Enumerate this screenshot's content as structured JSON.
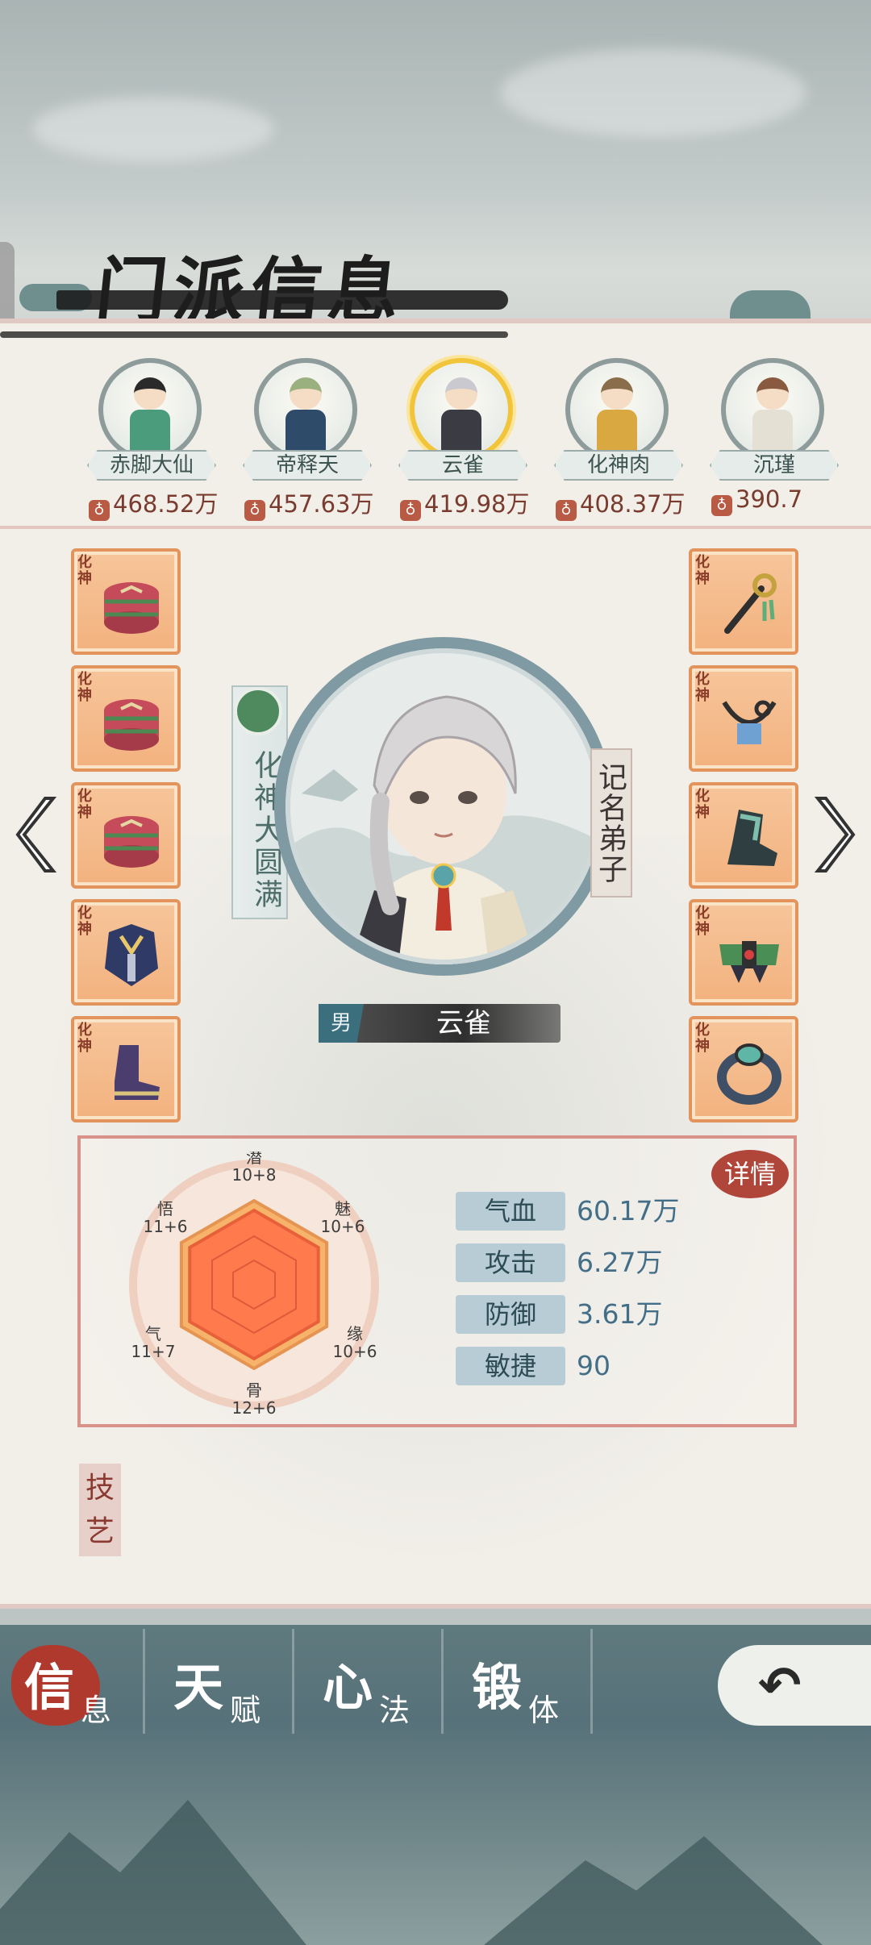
{
  "header": {
    "title": "门派信息"
  },
  "roster": [
    {
      "name": "赤脚大仙",
      "power": "468.52万",
      "hair": "#2a2a2a",
      "cloth": "#4a9c7d",
      "selected": false
    },
    {
      "name": "帝释天",
      "power": "457.63万",
      "hair": "#9bb07f",
      "cloth": "#2f4b6a",
      "selected": false
    },
    {
      "name": "云雀",
      "power": "419.98万",
      "hair": "#c9c9cf",
      "cloth": "#3b3b44",
      "selected": true
    },
    {
      "name": "化神肉",
      "power": "408.37万",
      "hair": "#8a6d4a",
      "cloth": "#d9a840",
      "selected": false
    },
    {
      "name": "沉瑾",
      "power": "390.7",
      "hair": "#8a5a40",
      "cloth": "#e4e0d4",
      "selected": false
    }
  ],
  "equipment": {
    "tag": "化神",
    "left": [
      "drum-icon",
      "drum-icon",
      "drum-icon",
      "armor-icon",
      "boot-icon"
    ],
    "right": [
      "staff-icon",
      "necklace-icon",
      "boot-jade-icon",
      "belt-icon",
      "ring-icon"
    ]
  },
  "character": {
    "realm": "化神大圆满",
    "rank": "记名弟子",
    "gender": "男",
    "name": "云雀"
  },
  "radar": {
    "axes": [
      {
        "key": "潜",
        "value": "10+8"
      },
      {
        "key": "魅",
        "value": "10+6"
      },
      {
        "key": "缘",
        "value": "10+6"
      },
      {
        "key": "骨",
        "value": "12+6"
      },
      {
        "key": "气",
        "value": "11+7"
      },
      {
        "key": "悟",
        "value": "11+6"
      }
    ]
  },
  "stats": [
    {
      "label": "气血",
      "value": "60.17万"
    },
    {
      "label": "攻击",
      "value": "6.27万"
    },
    {
      "label": "防御",
      "value": "3.61万"
    },
    {
      "label": "敏捷",
      "value": "90"
    }
  ],
  "detail_label": "详情",
  "skills_label": "技艺",
  "tabs": [
    {
      "big": "信",
      "small": "息",
      "active": true
    },
    {
      "big": "天",
      "small": "赋",
      "active": false
    },
    {
      "big": "心",
      "small": "法",
      "active": false
    },
    {
      "big": "锻",
      "small": "体",
      "active": false
    }
  ],
  "colors": {
    "accent_red": "#b0392e",
    "panel": "#f2efe9",
    "equip_orange": "#f3b27f"
  }
}
